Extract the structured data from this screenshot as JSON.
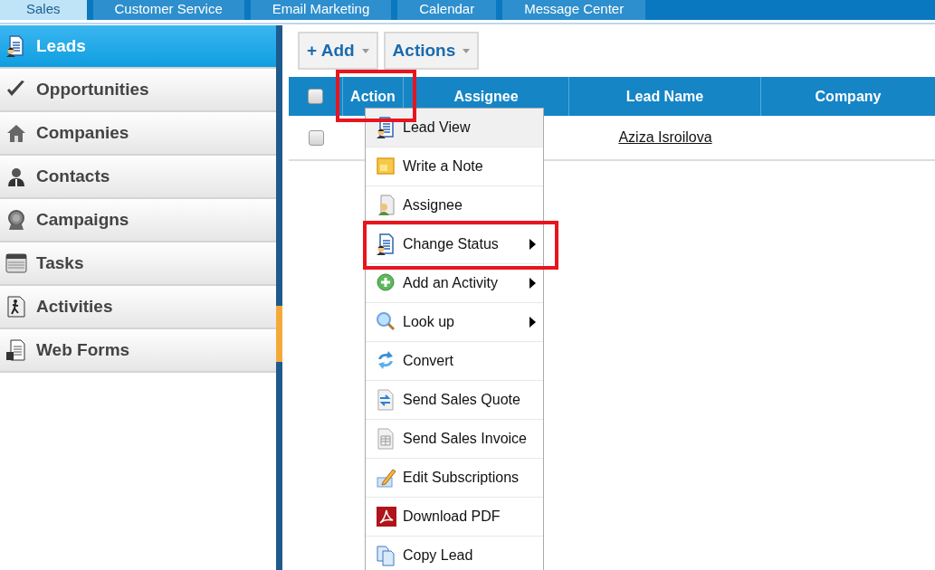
{
  "tabs": [
    {
      "label": "Sales",
      "selected": true
    },
    {
      "label": "Customer Service",
      "selected": false
    },
    {
      "label": "Email Marketing",
      "selected": false
    },
    {
      "label": "Calendar",
      "selected": false
    },
    {
      "label": "Message Center",
      "selected": false
    }
  ],
  "sidebar": {
    "items": [
      {
        "label": "Leads",
        "selected": true
      },
      {
        "label": "Opportunities",
        "selected": false
      },
      {
        "label": "Companies",
        "selected": false
      },
      {
        "label": "Contacts",
        "selected": false
      },
      {
        "label": "Campaigns",
        "selected": false
      },
      {
        "label": "Tasks",
        "selected": false
      },
      {
        "label": "Activities",
        "selected": false
      },
      {
        "label": "Web Forms",
        "selected": false
      }
    ]
  },
  "toolbar": {
    "buttons": [
      {
        "label": "+ Add"
      },
      {
        "label": "Actions"
      }
    ]
  },
  "table": {
    "columns": [
      {
        "label": "Action",
        "annotated": true
      },
      {
        "label": "Assignee",
        "annotated": false
      },
      {
        "label": "Lead Name",
        "annotated": false
      },
      {
        "label": "Company",
        "annotated": false
      }
    ],
    "all_checked": false,
    "rows": [
      {
        "checked": false,
        "lead_name": "Aziza Isroilova"
      }
    ]
  },
  "action_menu": {
    "items": [
      {
        "label": "Lead View",
        "hovered": true,
        "has_submenu": false,
        "annotated": false
      },
      {
        "label": "Write a Note",
        "hovered": false,
        "has_submenu": false,
        "annotated": false
      },
      {
        "label": "Assignee",
        "hovered": false,
        "has_submenu": false,
        "annotated": false
      },
      {
        "label": "Change Status",
        "hovered": false,
        "has_submenu": true,
        "annotated": true
      },
      {
        "label": "Add an Activity",
        "hovered": false,
        "has_submenu": true,
        "annotated": false
      },
      {
        "label": "Look up",
        "hovered": false,
        "has_submenu": true,
        "annotated": false
      },
      {
        "label": "Convert",
        "hovered": false,
        "has_submenu": false,
        "annotated": false
      },
      {
        "label": "Send Sales Quote",
        "hovered": false,
        "has_submenu": false,
        "annotated": false
      },
      {
        "label": "Send Sales Invoice",
        "hovered": false,
        "has_submenu": false,
        "annotated": false
      },
      {
        "label": "Edit Subscriptions",
        "hovered": false,
        "has_submenu": false,
        "annotated": false
      },
      {
        "label": "Download PDF",
        "hovered": false,
        "has_submenu": false,
        "annotated": false
      },
      {
        "label": "Copy Lead",
        "hovered": false,
        "has_submenu": false,
        "annotated": false
      }
    ]
  }
}
